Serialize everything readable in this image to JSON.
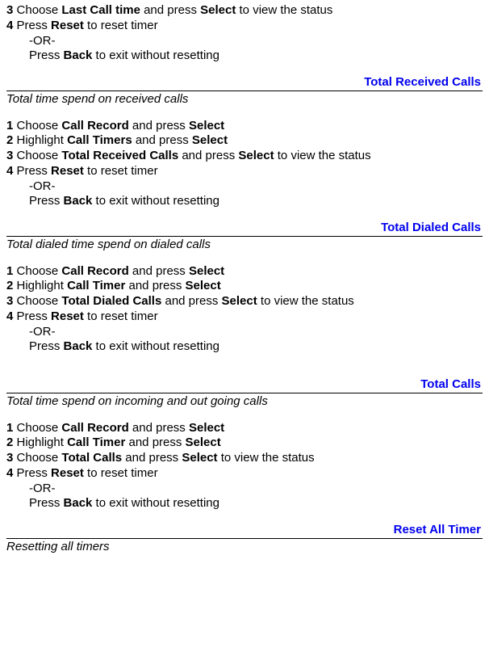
{
  "intro": {
    "step3_prefix": "3 ",
    "step3_mid1": "Choose ",
    "step3_b1": "Last Call time",
    "step3_mid2": " and press ",
    "step3_b2": "Select",
    "step3_suffix": " to view the status",
    "step4_prefix": "4 ",
    "step4_mid": "Press ",
    "step4_b": "Reset",
    "step4_suffix": " to reset timer",
    "or": "-OR-",
    "back_mid": "Press ",
    "back_b": "Back",
    "back_suffix": " to exit without resetting"
  },
  "sections": [
    {
      "title": "Total Received Calls",
      "desc": "Total time spend on received calls",
      "s1a": "Choose ",
      "s1b": "Call Record",
      "s1c": " and press ",
      "s1d": "Select",
      "s2a": "Highlight ",
      "s2b": "Call Timers",
      "s2c": " and press ",
      "s2d": "Select",
      "s3a": "Choose ",
      "s3b": "Total Received Calls",
      "s3c": " and press ",
      "s3d": "Select",
      "s3e": " to view the status",
      "s4a": "Press ",
      "s4b": "Reset",
      "s4c": " to reset timer",
      "or": "-OR-",
      "bka": "Press ",
      "bkb": "Back",
      "bkc": " to exit without resetting"
    },
    {
      "title": "Total Dialed Calls",
      "desc": "Total dialed time spend on dialed calls",
      "s1a": "Choose ",
      "s1b": "Call Record",
      "s1c": " and press ",
      "s1d": "Select",
      "s2a": "Highlight ",
      "s2b": "Call Timer",
      "s2c": " and press ",
      "s2d": "Select",
      "s3a": "Choose ",
      "s3b": "Total Dialed Calls",
      "s3c": " and press ",
      "s3d": "Select",
      "s3e": " to view the status",
      "s4a": "Press ",
      "s4b": "Reset",
      "s4c": " to reset timer",
      "or": "-OR-",
      "bka": "Press ",
      "bkb": "Back",
      "bkc": " to exit without resetting"
    },
    {
      "title": "Total Calls",
      "desc": "Total time spend on incoming and out going calls",
      "s1a": "Choose ",
      "s1b": "Call Record",
      "s1c": " and press ",
      "s1d": "Select",
      "s2a": "Highlight ",
      "s2b": "Call Timer",
      "s2c": " and press ",
      "s2d": "Select",
      "s3a": "Choose ",
      "s3b": "Total Calls",
      "s3c": " and press ",
      "s3d": "Select",
      "s3e": " to view the status",
      "s4a": "Press ",
      "s4b": "Reset",
      "s4c": " to reset timer",
      "or": "-OR-",
      "bka": "Press ",
      "bkb": "Back",
      "bkc": " to exit without resetting"
    }
  ],
  "reset": {
    "title": "Reset All Timer",
    "desc": "Resetting all timers"
  },
  "nums": {
    "n1": "1 ",
    "n2": "2 ",
    "n3": "3 ",
    "n4": "4 "
  }
}
